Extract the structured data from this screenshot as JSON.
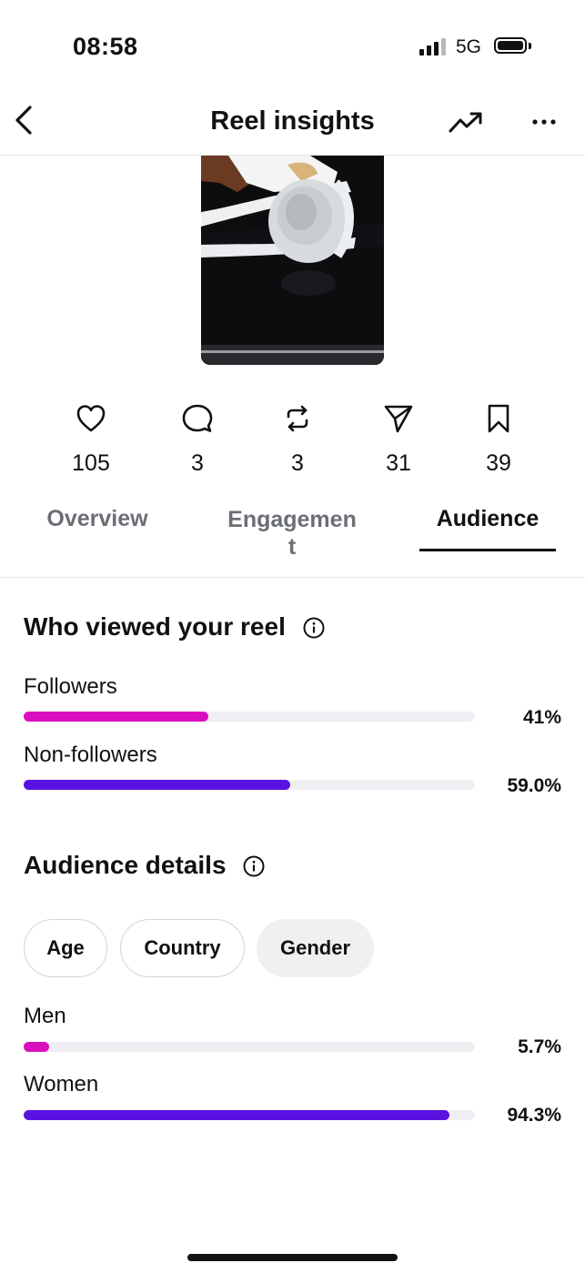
{
  "status": {
    "time": "08:58",
    "network": "5G"
  },
  "header": {
    "title": "Reel insights"
  },
  "metrics": [
    {
      "icon": "heart-icon",
      "value": "105"
    },
    {
      "icon": "comment-icon",
      "value": "3"
    },
    {
      "icon": "repost-icon",
      "value": "3"
    },
    {
      "icon": "share-icon",
      "value": "31"
    },
    {
      "icon": "bookmark-icon",
      "value": "39"
    }
  ],
  "tabs": [
    {
      "label": "Overview"
    },
    {
      "label": "Engagemen\nt"
    },
    {
      "label": "Audience"
    }
  ],
  "active_tab": "Audience",
  "viewers": {
    "title": "Who viewed your reel",
    "rows": [
      {
        "label": "Followers",
        "value": "41%",
        "fraction": 0.41,
        "color": "#d90fbf"
      },
      {
        "label": "Non-followers",
        "value": "59.0%",
        "fraction": 0.59,
        "color": "#5a12e0"
      }
    ]
  },
  "audience": {
    "title": "Audience details",
    "chips": [
      "Age",
      "Country",
      "Gender"
    ],
    "selected_chip": "Gender",
    "rows": [
      {
        "label": "Men",
        "value": "5.7%",
        "fraction": 0.057,
        "color": "#d90fbf"
      },
      {
        "label": "Women",
        "value": "94.3%",
        "fraction": 0.943,
        "color": "#5a12e0"
      }
    ]
  }
}
